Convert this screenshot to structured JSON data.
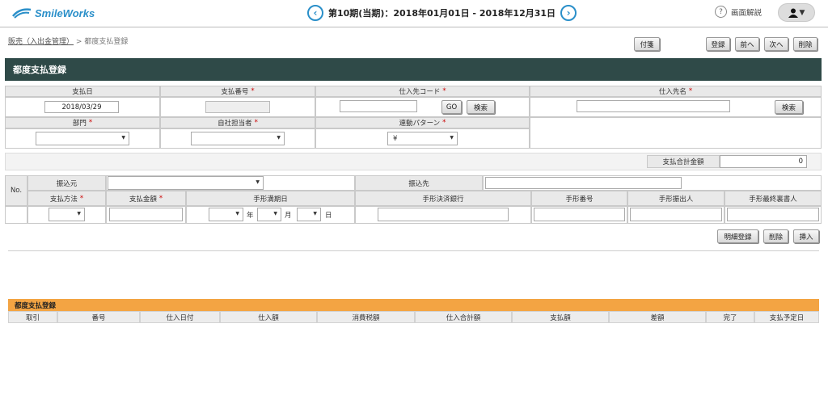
{
  "header": {
    "logo": "SmileWorks",
    "period_label": "第10期(当期)：2018年01月01日 - 2018年12月31日",
    "help_label": "画面解説",
    "user_menu": "▼"
  },
  "breadcrumb": {
    "parent": "販売（入出金管理）",
    "sep": ">",
    "current": "都度支払登録"
  },
  "toolbar": {
    "attach": "付箋",
    "register": "登録",
    "prev": "前へ",
    "next": "次へ",
    "delete": "削除"
  },
  "form": {
    "title": "都度支払登録",
    "pay_date_label": "支払日",
    "pay_date_value": "2018/03/29",
    "pay_no_label": "支払番号",
    "supplier_code_label": "仕入先コード",
    "go_label": "GO",
    "search_label": "検索",
    "supplier_name_label": "仕入先名",
    "dept_label": "部門",
    "staff_label": "自社担当者",
    "pattern_label": "連動パターン",
    "pattern_value": "¥",
    "req_mark": "*"
  },
  "total": {
    "label": "支払合計金額",
    "value": "0"
  },
  "detail": {
    "no_label": "No.",
    "transfer_from_label": "振込元",
    "transfer_to_label": "振込先",
    "method_label": "支払方法",
    "amount_label": "支払金額",
    "due_date_label": "手形満期日",
    "year_label": "年",
    "month_label": "月",
    "day_label": "日",
    "bank_label": "手形決済銀行",
    "bill_no_label": "手形番号",
    "drawer_label": "手形振出人",
    "endorser_label": "手形最終裏書人"
  },
  "detail_buttons": {
    "register": "明細登録",
    "delete": "削除",
    "insert": "挿入"
  },
  "grid": {
    "title": "都度支払登録",
    "columns": [
      "取引",
      "番号",
      "仕入日付",
      "仕入額",
      "消費税額",
      "仕入合計額",
      "支払額",
      "差額",
      "完了",
      "支払予定日"
    ]
  }
}
